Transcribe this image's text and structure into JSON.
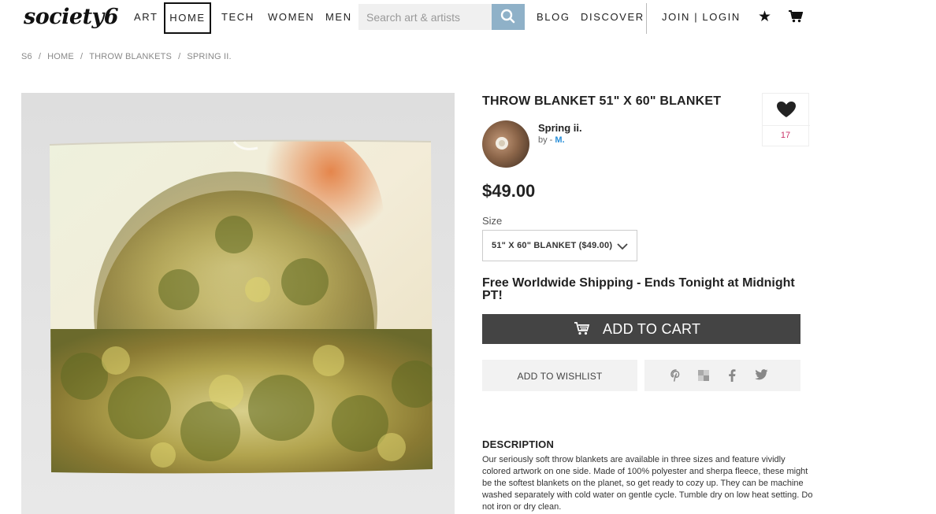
{
  "header": {
    "logo": "society6",
    "nav": [
      "ART",
      "HOME",
      "TECH",
      "WOMEN",
      "MEN"
    ],
    "search_placeholder": "Search art & artists",
    "links": [
      "BLOG",
      "DISCOVER"
    ],
    "account": "JOIN | LOGIN"
  },
  "breadcrumb": [
    "S6",
    "HOME",
    "THROW BLANKETS",
    "SPRING II."
  ],
  "product": {
    "title": "THROW BLANKET 51\" X 60\" BLANKET",
    "artwork_name": "Spring ii.",
    "by_label": "by -",
    "artist": "M.",
    "price": "$49.00",
    "size_label": "Size",
    "size_value": "51\" X 60\" BLANKET ($49.00)",
    "shipping_notice": "Free Worldwide Shipping - Ends Tonight at Midnight PT!",
    "add_to_cart": "ADD TO CART",
    "add_to_wishlist": "ADD TO WISHLIST",
    "like_count": "17"
  },
  "description": {
    "heading": "DESCRIPTION",
    "text": "Our seriously soft throw blankets are available in three sizes and feature vividly colored artwork on one side. Made of 100% polyester and sherpa fleece, these might be the softest blankets on the planet, so get ready to cozy up. They can be machine washed separately with cold water on gentle cycle. Tumble dry on low heat setting. Do not iron or dry clean."
  },
  "icons": {
    "search": "search-icon",
    "star": "star-icon",
    "cart": "cart-icon",
    "heart": "heart-icon",
    "share": [
      "pinterest-icon",
      "tumblr-icon",
      "facebook-icon",
      "twitter-icon"
    ]
  },
  "colors": {
    "search_button": "#8fb1c8",
    "add_to_cart_bg": "#444444",
    "artist_link": "#2a8fd8",
    "like_count": "#c9336a"
  }
}
